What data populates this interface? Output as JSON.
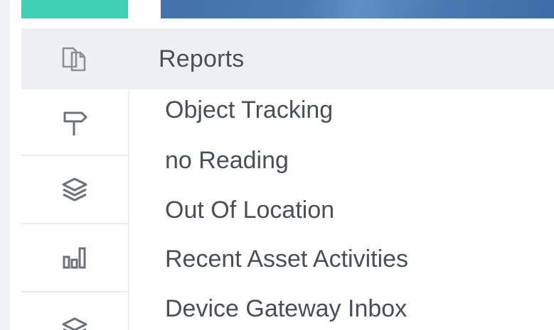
{
  "colors": {
    "accent_green": "#3ed1b6",
    "header_blue": "#3f6fa8",
    "menu_bg": "#eef0f3",
    "text": "#4a4f55",
    "icon": "#6b7178"
  },
  "sidebar": {
    "icons": [
      {
        "name": "reports-copy-icon",
        "active": true
      },
      {
        "name": "signpost-icon",
        "active": false
      },
      {
        "name": "layers-icon",
        "active": false
      },
      {
        "name": "bar-chart-icon",
        "active": false
      },
      {
        "name": "layers-icon",
        "active": false
      }
    ]
  },
  "menu": {
    "header": "Reports",
    "items": [
      "Object Tracking",
      "no Reading",
      "Out Of Location",
      "Recent Asset Activities",
      "Device Gateway Inbox"
    ]
  }
}
